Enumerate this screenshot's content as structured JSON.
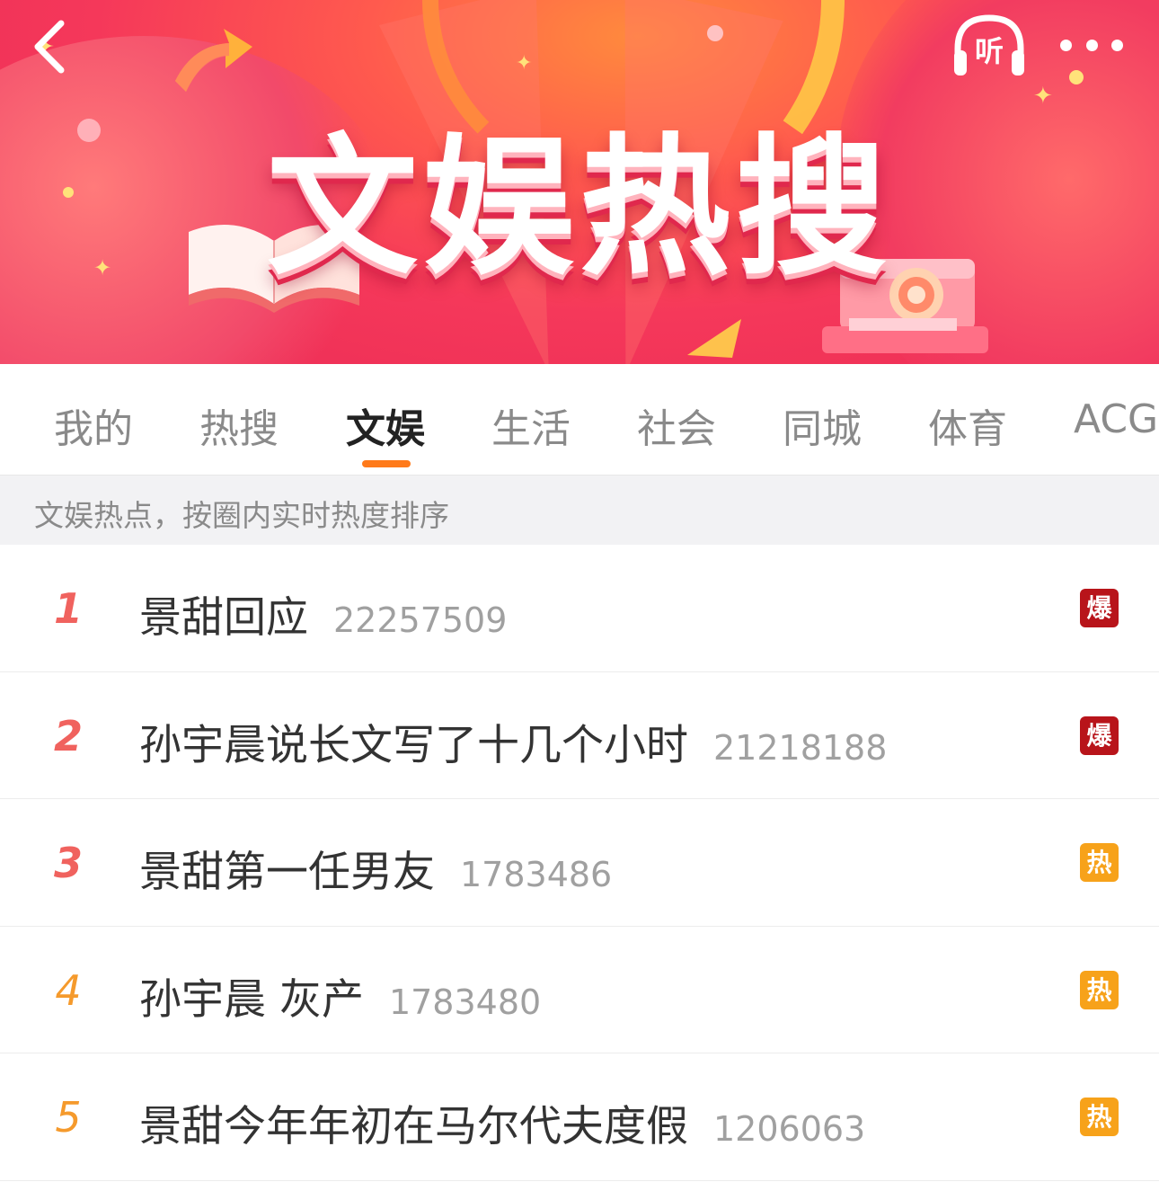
{
  "banner": {
    "title": "文娱热搜",
    "listen_label": "听"
  },
  "tabs": [
    {
      "label": "我的"
    },
    {
      "label": "热搜"
    },
    {
      "label": "文娱",
      "active": true
    },
    {
      "label": "生活"
    },
    {
      "label": "社会"
    },
    {
      "label": "同城"
    },
    {
      "label": "体育"
    },
    {
      "label": "ACG"
    }
  ],
  "subheader": "文娱热点，按圈内实时热度排序",
  "list": [
    {
      "rank": "1",
      "topic": "景甜回应",
      "heat": "22257509",
      "badge": "爆"
    },
    {
      "rank": "2",
      "topic": "孙宇晨说长文写了十几个小时",
      "heat": "21218188",
      "badge": "爆"
    },
    {
      "rank": "3",
      "topic": "景甜第一任男友",
      "heat": "1783486",
      "badge": "热"
    },
    {
      "rank": "4",
      "topic": "孙宇晨 灰产",
      "heat": "1783480",
      "badge": "热"
    },
    {
      "rank": "5",
      "topic": "景甜今年年初在马尔代夫度假",
      "heat": "1206063",
      "badge": "热"
    }
  ],
  "colors": {
    "accent": "#ff7a1a",
    "badge_bao": "#b8141a",
    "badge_re": "#f7a21a",
    "rank_top": "#f0625e",
    "rank_other": "#f59a2c"
  },
  "icons": {
    "back": "chevron-left-icon",
    "listen": "headphones-icon",
    "more": "more-dots-icon"
  }
}
